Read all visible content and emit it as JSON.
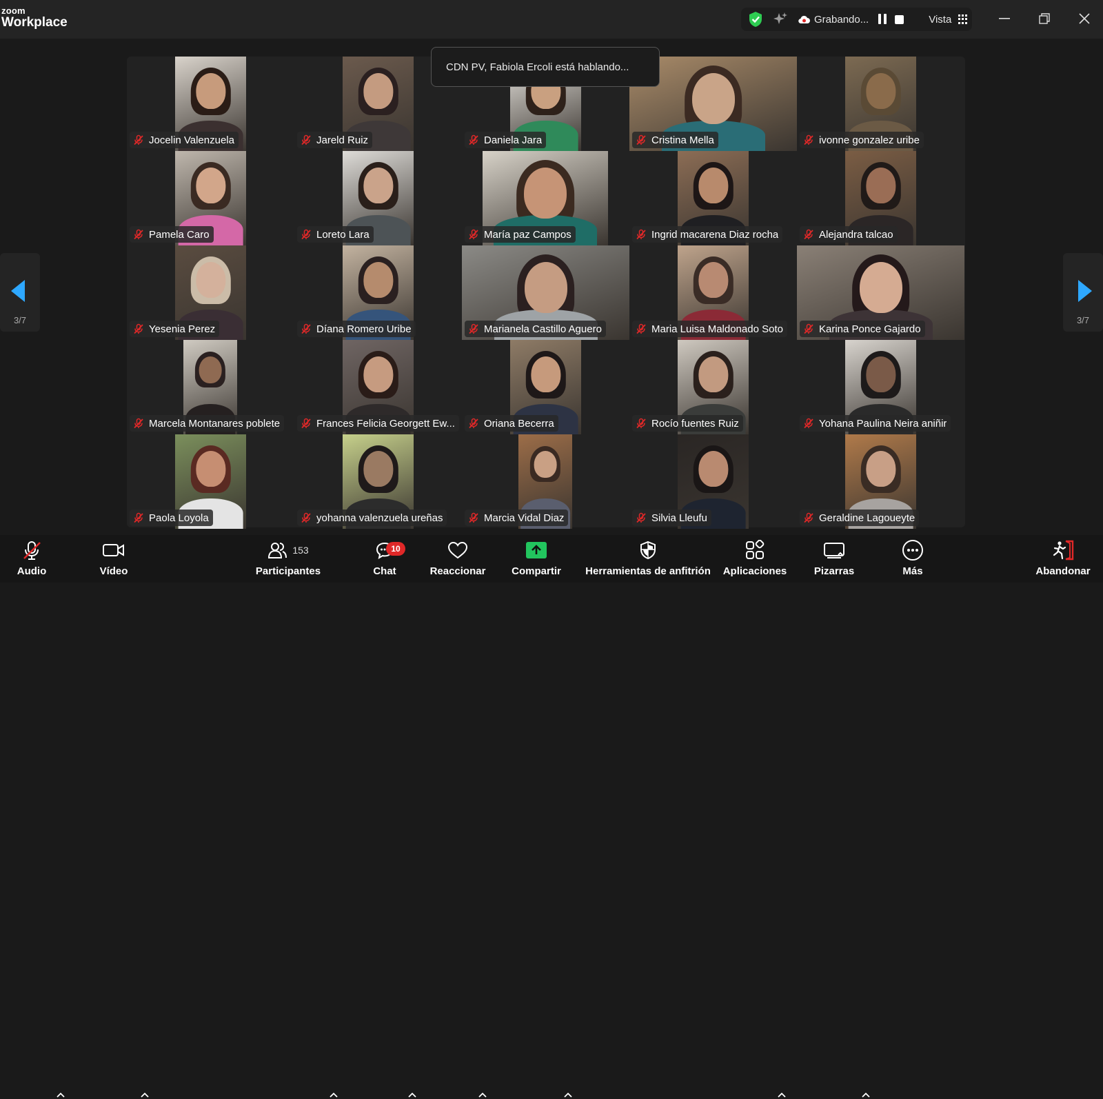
{
  "app": {
    "logo_top": "zoom",
    "logo_bottom": "Workplace"
  },
  "status": {
    "recording_label": "Grabando...",
    "view_label": "Vista"
  },
  "speaker_toast": "CDN PV, Fabiola Ercoli está hablando...",
  "page_indicator": "3/7",
  "participants": [
    {
      "name": "Jocelin Valenzuela",
      "skin": "#c79b7c",
      "hair": "#2a1c16",
      "shirt": "#3b3030",
      "bg": "#d9d3cb"
    },
    {
      "name": "Jareld Ruiz",
      "skin": "#c49b80",
      "hair": "#2b2020",
      "shirt": "#3e3838",
      "bg": "#6b5a4d"
    },
    {
      "name": "Daniela Jara",
      "skin": "#c9a080",
      "hair": "#2e211a",
      "shirt": "#2f8a5a",
      "bg": "#e9e6e0"
    },
    {
      "name": "Cristina Mella",
      "skin": "#c9a488",
      "hair": "#3b2a22",
      "shirt": "#2a6d76",
      "bg": "#a98b69"
    },
    {
      "name": "ivonne gonzalez uribe",
      "skin": "#8a6b4b",
      "hair": "#5a4a35",
      "shirt": "#6b5a45",
      "bg": "#7c6a52"
    },
    {
      "name": "Pamela Caro",
      "skin": "#d2a68a",
      "hair": "#3a2a22",
      "shirt": "#d468a7",
      "bg": "#bfb7ad"
    },
    {
      "name": "Loreto Lara",
      "skin": "#caa38a",
      "hair": "#2a1f1a",
      "shirt": "#4d5356",
      "bg": "#dedcd8"
    },
    {
      "name": "María paz Campos",
      "skin": "#c69476",
      "hair": "#3b2a20",
      "shirt": "#1f6d66",
      "bg": "#d7d2c8"
    },
    {
      "name": "Ingrid macarena Diaz rocha",
      "skin": "#b88a6c",
      "hair": "#1d1616",
      "shirt": "#1f1f22",
      "bg": "#8c6d55"
    },
    {
      "name": "Alejandra talcao",
      "skin": "#9a6d55",
      "hair": "#201a18",
      "shirt": "#2b2626",
      "bg": "#7b5d44"
    },
    {
      "name": "Yesenia Perez",
      "skin": "#d4b19c",
      "hair": "#cbbca8",
      "shirt": "#3a2e34",
      "bg": "#5a4c40"
    },
    {
      "name": "Díana Romero Uribe",
      "skin": "#b58b6d",
      "hair": "#2a2020",
      "shirt": "#35547b",
      "bg": "#c3b3a0"
    },
    {
      "name": "Marianela Castillo Aguero",
      "skin": "#c59c82",
      "hair": "#2b2020",
      "shirt": "#9ea3a6",
      "bg": "#8b8a86"
    },
    {
      "name": "Maria Luisa Maldonado Soto",
      "skin": "#b88a72",
      "hair": "#3a2c26",
      "shirt": "#8b2a36",
      "bg": "#bfa48c"
    },
    {
      "name": "Karina Ponce Gajardo",
      "skin": "#d5ab92",
      "hair": "#24191a",
      "shirt": "#3d3336",
      "bg": "#8a8076"
    },
    {
      "name": "Marcela Montanares poblete",
      "skin": "#8f6a52",
      "hair": "#2a2020",
      "shirt": "#252020",
      "bg": "#d0cbc2"
    },
    {
      "name": "Frances Felicia Georgett Ew...",
      "skin": "#c69b80",
      "hair": "#2a1c18",
      "shirt": "#2e2a2a",
      "bg": "#6f6563"
    },
    {
      "name": "Oriana Becerra",
      "skin": "#c69a7c",
      "hair": "#1e1818",
      "shirt": "#2d3344",
      "bg": "#8e7b66"
    },
    {
      "name": "Rocío fuentes Ruiz",
      "skin": "#c29a80",
      "hair": "#2a201c",
      "shirt": "#3a3c3a",
      "bg": "#cfc9c0"
    },
    {
      "name": "Yohana Paulina Neira aniñir",
      "skin": "#7a5a48",
      "hair": "#1d1a1a",
      "shirt": "#2a2a2a",
      "bg": "#d8d4ce"
    },
    {
      "name": "Paola Loyola",
      "skin": "#c68e72",
      "hair": "#5a2a22",
      "shirt": "#e4e4e4",
      "bg": "#7b8f5c"
    },
    {
      "name": "yohanna valenzuela ureñas",
      "skin": "#9a7a62",
      "hair": "#1f1a1a",
      "shirt": "#2c2c2c",
      "bg": "#c6d08b"
    },
    {
      "name": "Marcia Vidal Diaz",
      "skin": "#c9a084",
      "hair": "#3a2a22",
      "shirt": "#5a5e6e",
      "bg": "#9c6d48"
    },
    {
      "name": "Silvia Lleufu",
      "skin": "#b98a70",
      "hair": "#1a1616",
      "shirt": "#1e2430",
      "bg": "#2a2624"
    },
    {
      "name": "Geraldine Lagoueyte",
      "skin": "#c89f86",
      "hair": "#3a2c24",
      "shirt": "#a7a3a0",
      "bg": "#b07a4a"
    }
  ],
  "toolbar": {
    "audio": "Audio",
    "video": "Vídeo",
    "participants": "Participantes",
    "participants_count": "153",
    "chat": "Chat",
    "chat_badge": "10",
    "react": "Reaccionar",
    "share": "Compartir",
    "host_tools": "Herramientas de anfitrión",
    "apps": "Aplicaciones",
    "whiteboards": "Pizarras",
    "more": "Más",
    "leave": "Abandonar"
  },
  "colors": {
    "share_green": "#22c55e",
    "accent_blue": "#2ea8ff",
    "mute_red": "#e02828"
  }
}
